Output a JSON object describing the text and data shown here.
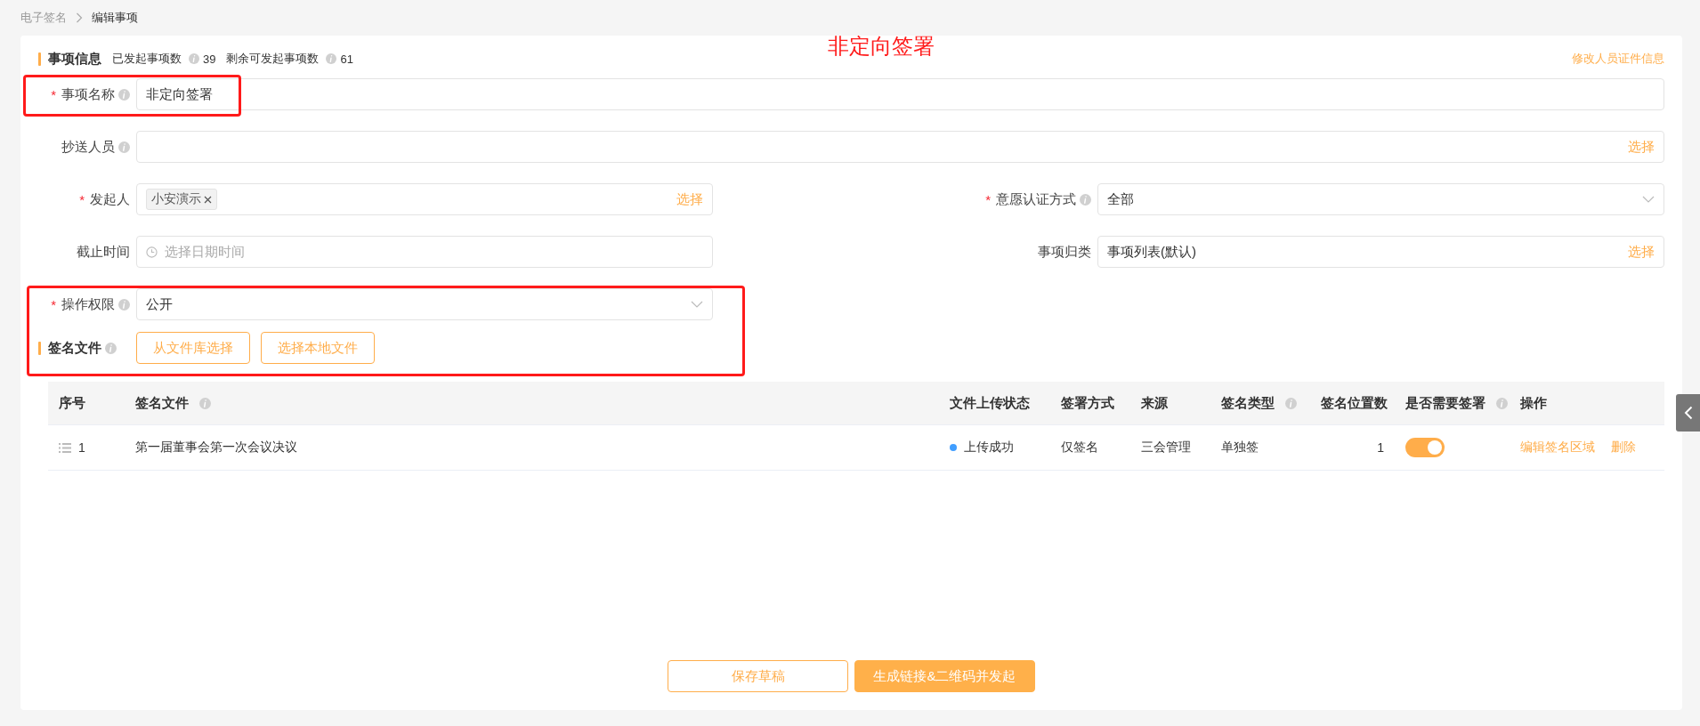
{
  "breadcrumb": {
    "items": [
      "电子签名"
    ],
    "current": "编辑事项"
  },
  "annotation": {
    "text": "非定向签署"
  },
  "section": {
    "title": "事项信息",
    "stats": [
      {
        "label": "已发起事项数",
        "value": "39"
      },
      {
        "label": "剩余可发起事项数",
        "value": "61"
      }
    ],
    "link": "修改人员证件信息"
  },
  "form_rows": [
    [
      {
        "required_mark": "*",
        "label": "事项名称",
        "info": true,
        "kind": "text",
        "value": "非定向签署"
      }
    ],
    [
      {
        "label": "抄送人员",
        "info": true,
        "kind": "picker",
        "action": "选择"
      }
    ],
    [
      {
        "required_mark": "*",
        "label": "发起人",
        "info": false,
        "kind": "tags",
        "tags": [
          "小安演示"
        ],
        "action": "选择"
      },
      {
        "required_mark": "*",
        "label": "意愿认证方式",
        "info": true,
        "kind": "select",
        "value": "全部"
      }
    ],
    [
      {
        "label": "截止时间",
        "info": false,
        "kind": "date",
        "placeholder": "选择日期时间"
      },
      {
        "label": "事项归类",
        "info": false,
        "kind": "picker",
        "value": "事项列表(默认)",
        "action": "选择"
      }
    ],
    [
      {
        "required_mark": "*",
        "label": "操作权限",
        "info": true,
        "kind": "select",
        "value": "公开"
      }
    ]
  ],
  "files": {
    "title": "签名文件",
    "info": true,
    "buttons": [
      "从文件库选择",
      "选择本地文件"
    ]
  },
  "table": {
    "columns": [
      {
        "label": "序号",
        "info": false
      },
      {
        "label": "签名文件",
        "info": true
      },
      {
        "label": "文件上传状态",
        "info": false
      },
      {
        "label": "签署方式",
        "info": false
      },
      {
        "label": "来源",
        "info": false
      },
      {
        "label": "签名类型",
        "info": true
      },
      {
        "label": "签名位置数",
        "info": false
      },
      {
        "label": "是否需要签署",
        "info": true
      },
      {
        "label": "操作",
        "info": false
      }
    ],
    "rows": [
      {
        "index": "1",
        "name": "第一届董事会第一次会议决议",
        "status": {
          "text": "上传成功",
          "color": "#409eff"
        },
        "method": "仅签名",
        "source": "三会管理",
        "type": "单独签",
        "positions": "1",
        "needs_sign": true,
        "actions": [
          "编辑签名区域",
          "删除"
        ]
      }
    ]
  },
  "footer": {
    "buttons": [
      {
        "label": "保存草稿",
        "kind": "outline"
      },
      {
        "label": "生成链接&二维码并发起",
        "kind": "primary"
      }
    ]
  }
}
